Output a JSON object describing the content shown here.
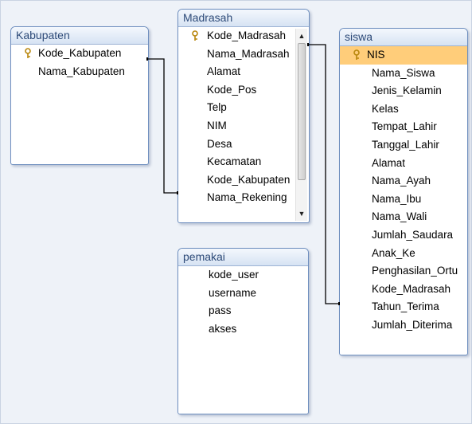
{
  "tables": {
    "kabupaten": {
      "title": "Kabupaten",
      "fields": [
        "Kode_Kabupaten",
        "Nama_Kabupaten"
      ]
    },
    "madrasah": {
      "title": "Madrasah",
      "fields": [
        "Kode_Madrasah",
        "Nama_Madrasah",
        "Alamat",
        "Kode_Pos",
        "Telp",
        "NIM",
        "Desa",
        "Kecamatan",
        "Kode_Kabupaten",
        "Nama_Rekening"
      ]
    },
    "siswa": {
      "title": "siswa",
      "fields": [
        "NIS",
        "Nama_Siswa",
        "Jenis_Kelamin",
        "Kelas",
        "Tempat_Lahir",
        "Tanggal_Lahir",
        "Alamat",
        "Nama_Ayah",
        "Nama_Ibu",
        "Nama_Wali",
        "Jumlah_Saudara",
        "Anak_Ke",
        "Penghasilan_Ortu",
        "Kode_Madrasah",
        "Tahun_Terima",
        "Jumlah_Diterima"
      ]
    },
    "pemakai": {
      "title": "pemakai",
      "fields": [
        "kode_user",
        "username",
        "pass",
        "akses"
      ]
    }
  },
  "colors": {
    "primary_key_highlight": "#ffcd7a",
    "title_text": "#2d4a78",
    "table_border": "#6f8fbf",
    "relation_line": "#000000"
  },
  "icons": {
    "primary_key": "key-icon"
  }
}
